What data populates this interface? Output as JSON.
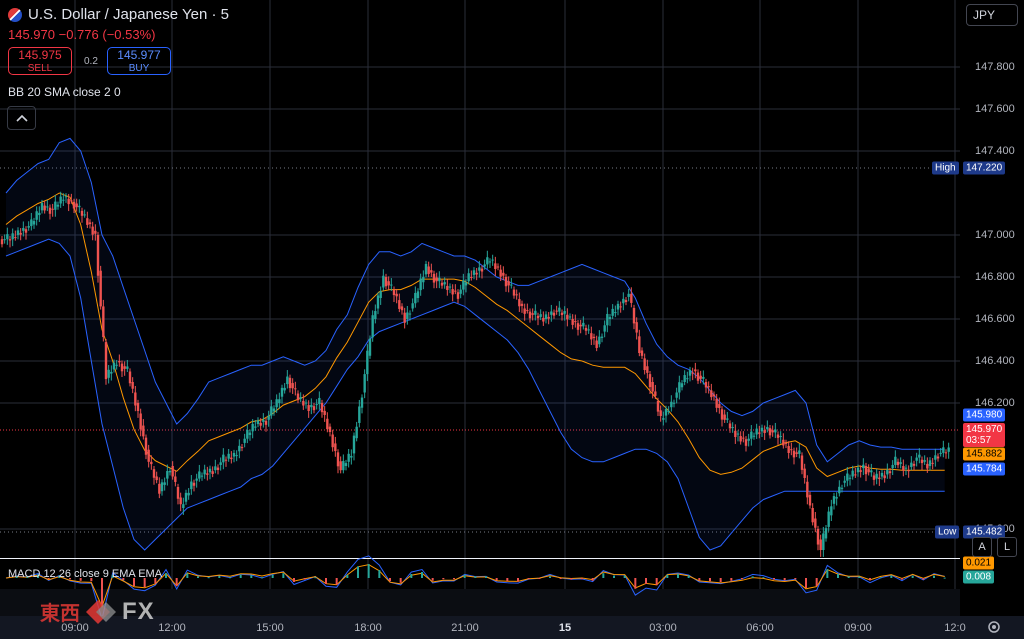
{
  "header": {
    "title": "U.S. Dollar / Japanese Yen · 5",
    "last": "145.970",
    "change": "−0.776 (−0.53%)",
    "sell": {
      "price": "145.975",
      "label": "SELL"
    },
    "buy": {
      "price": "145.977",
      "label": "BUY"
    },
    "spread": "0.2",
    "indicator": "BB 20 SMA close 2 0",
    "currency": "JPY"
  },
  "price_axis": [
    "147.800",
    "147.600",
    "147.400",
    "147.000",
    "146.800",
    "146.600",
    "146.400",
    "146.200",
    "145.600"
  ],
  "tags": {
    "high_label": "High",
    "high_value": "147.220",
    "low_label": "Low",
    "low_value": "145.482",
    "bb_upper": "145.980",
    "last_price": "145.970",
    "countdown": "03:57",
    "bb_basis": "145.882",
    "bb_lower": "145.784",
    "macd_a": "0.021",
    "macd_b": "0.008"
  },
  "macd_label": "MACD 12 26 close 9 EMA EMA",
  "time_axis": [
    "09:00",
    "12:00",
    "15:00",
    "18:00",
    "21:00",
    "15",
    "03:00",
    "06:00",
    "09:00",
    "12:0"
  ],
  "buttons": {
    "auto": "A",
    "log": "L"
  },
  "logo": {
    "cn": "東西",
    "fx": "FX"
  },
  "colors": {
    "up": "#26a69a",
    "down": "#ef5350",
    "bb": "#2962ff",
    "basis": "#ff9800",
    "grid": "#2a2e39"
  },
  "chart_data": {
    "type": "candlestick",
    "ylim": [
      145.45,
      147.9
    ],
    "close": [
      146.98,
      147.02,
      147.05,
      147.14,
      147.12,
      147.18,
      147.15,
      147.08,
      147.0,
      146.32,
      146.4,
      146.35,
      146.15,
      145.92,
      145.78,
      145.9,
      145.7,
      145.82,
      145.86,
      145.88,
      145.93,
      145.95,
      146.03,
      146.1,
      146.12,
      146.2,
      146.32,
      146.22,
      146.18,
      146.2,
      146.05,
      145.88,
      145.96,
      146.25,
      146.6,
      146.8,
      146.72,
      146.6,
      146.7,
      146.85,
      146.78,
      146.75,
      146.72,
      146.8,
      146.84,
      146.88,
      146.82,
      146.74,
      146.65,
      146.62,
      146.6,
      146.64,
      146.62,
      146.58,
      146.55,
      146.48,
      146.6,
      146.66,
      146.72,
      146.45,
      146.3,
      146.12,
      146.2,
      146.3,
      146.36,
      146.3,
      146.22,
      146.12,
      146.05,
      146.02,
      146.06,
      146.08,
      146.04,
      145.98,
      145.95,
      145.7,
      145.5,
      145.72,
      145.82,
      145.86,
      145.9,
      145.84,
      145.86,
      145.92,
      145.88,
      145.94,
      145.9,
      145.96,
      145.97
    ],
    "bb_upper": [
      147.2,
      147.26,
      147.3,
      147.34,
      147.36,
      147.44,
      147.46,
      147.4,
      147.25,
      147.0,
      146.9,
      146.75,
      146.6,
      146.45,
      146.3,
      146.2,
      146.1,
      146.15,
      146.22,
      146.3,
      146.32,
      146.34,
      146.36,
      146.38,
      146.38,
      146.4,
      146.42,
      146.4,
      146.38,
      146.4,
      146.45,
      146.55,
      146.62,
      146.75,
      146.86,
      146.92,
      146.92,
      146.9,
      146.92,
      146.96,
      146.94,
      146.92,
      146.9,
      146.9,
      146.88,
      146.84,
      146.8,
      146.78,
      146.76,
      146.76,
      146.78,
      146.8,
      146.82,
      146.84,
      146.86,
      146.84,
      146.82,
      146.8,
      146.78,
      146.7,
      146.58,
      146.48,
      146.42,
      146.38,
      146.36,
      146.32,
      146.26,
      146.2,
      146.16,
      146.14,
      146.16,
      146.2,
      146.22,
      146.24,
      146.26,
      146.2,
      146.0,
      145.92,
      145.96,
      146.0,
      146.02,
      146.0,
      145.99,
      145.99,
      145.98,
      145.98,
      145.98,
      145.98,
      145.98
    ],
    "bb_lower": [
      146.9,
      146.92,
      146.94,
      146.96,
      146.98,
      146.96,
      146.9,
      146.7,
      146.4,
      146.1,
      145.9,
      145.7,
      145.55,
      145.5,
      145.55,
      145.6,
      145.65,
      145.7,
      145.72,
      145.74,
      145.76,
      145.78,
      145.8,
      145.84,
      145.86,
      145.9,
      145.96,
      146.02,
      146.08,
      146.14,
      146.2,
      146.28,
      146.36,
      146.42,
      146.5,
      146.54,
      146.56,
      146.58,
      146.6,
      146.62,
      146.64,
      146.66,
      146.68,
      146.66,
      146.62,
      146.58,
      146.54,
      146.5,
      146.44,
      146.36,
      146.26,
      146.16,
      146.06,
      145.98,
      145.94,
      145.92,
      145.92,
      145.94,
      145.96,
      145.98,
      145.98,
      145.96,
      145.92,
      145.84,
      145.7,
      145.56,
      145.5,
      145.52,
      145.58,
      145.64,
      145.7,
      145.74,
      145.76,
      145.78,
      145.78,
      145.78,
      145.78,
      145.78,
      145.78,
      145.78,
      145.78,
      145.78,
      145.78,
      145.78,
      145.78,
      145.78,
      145.78,
      145.78,
      145.78
    ]
  }
}
